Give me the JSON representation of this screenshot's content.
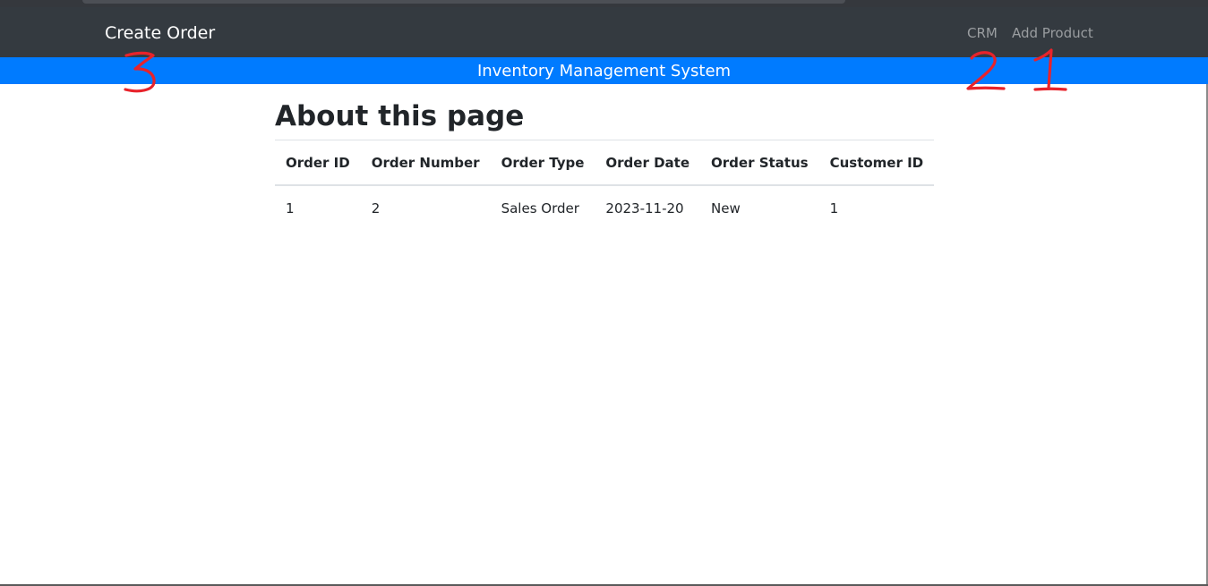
{
  "navbar": {
    "brand": "Create Order",
    "links": [
      {
        "label": "CRM"
      },
      {
        "label": "Add Product"
      }
    ]
  },
  "banner": {
    "title": "Inventory Management System"
  },
  "main": {
    "heading": "About this page",
    "table": {
      "headers": [
        "Order ID",
        "Order Number",
        "Order Type",
        "Order Date",
        "Order Status",
        "Customer ID"
      ],
      "rows": [
        [
          "1",
          "2",
          "Sales Order",
          "2023-11-20",
          "New",
          "1"
        ]
      ]
    }
  },
  "annotations": {
    "color": "#e8232b",
    "marks": [
      "3",
      "2",
      "1"
    ]
  }
}
